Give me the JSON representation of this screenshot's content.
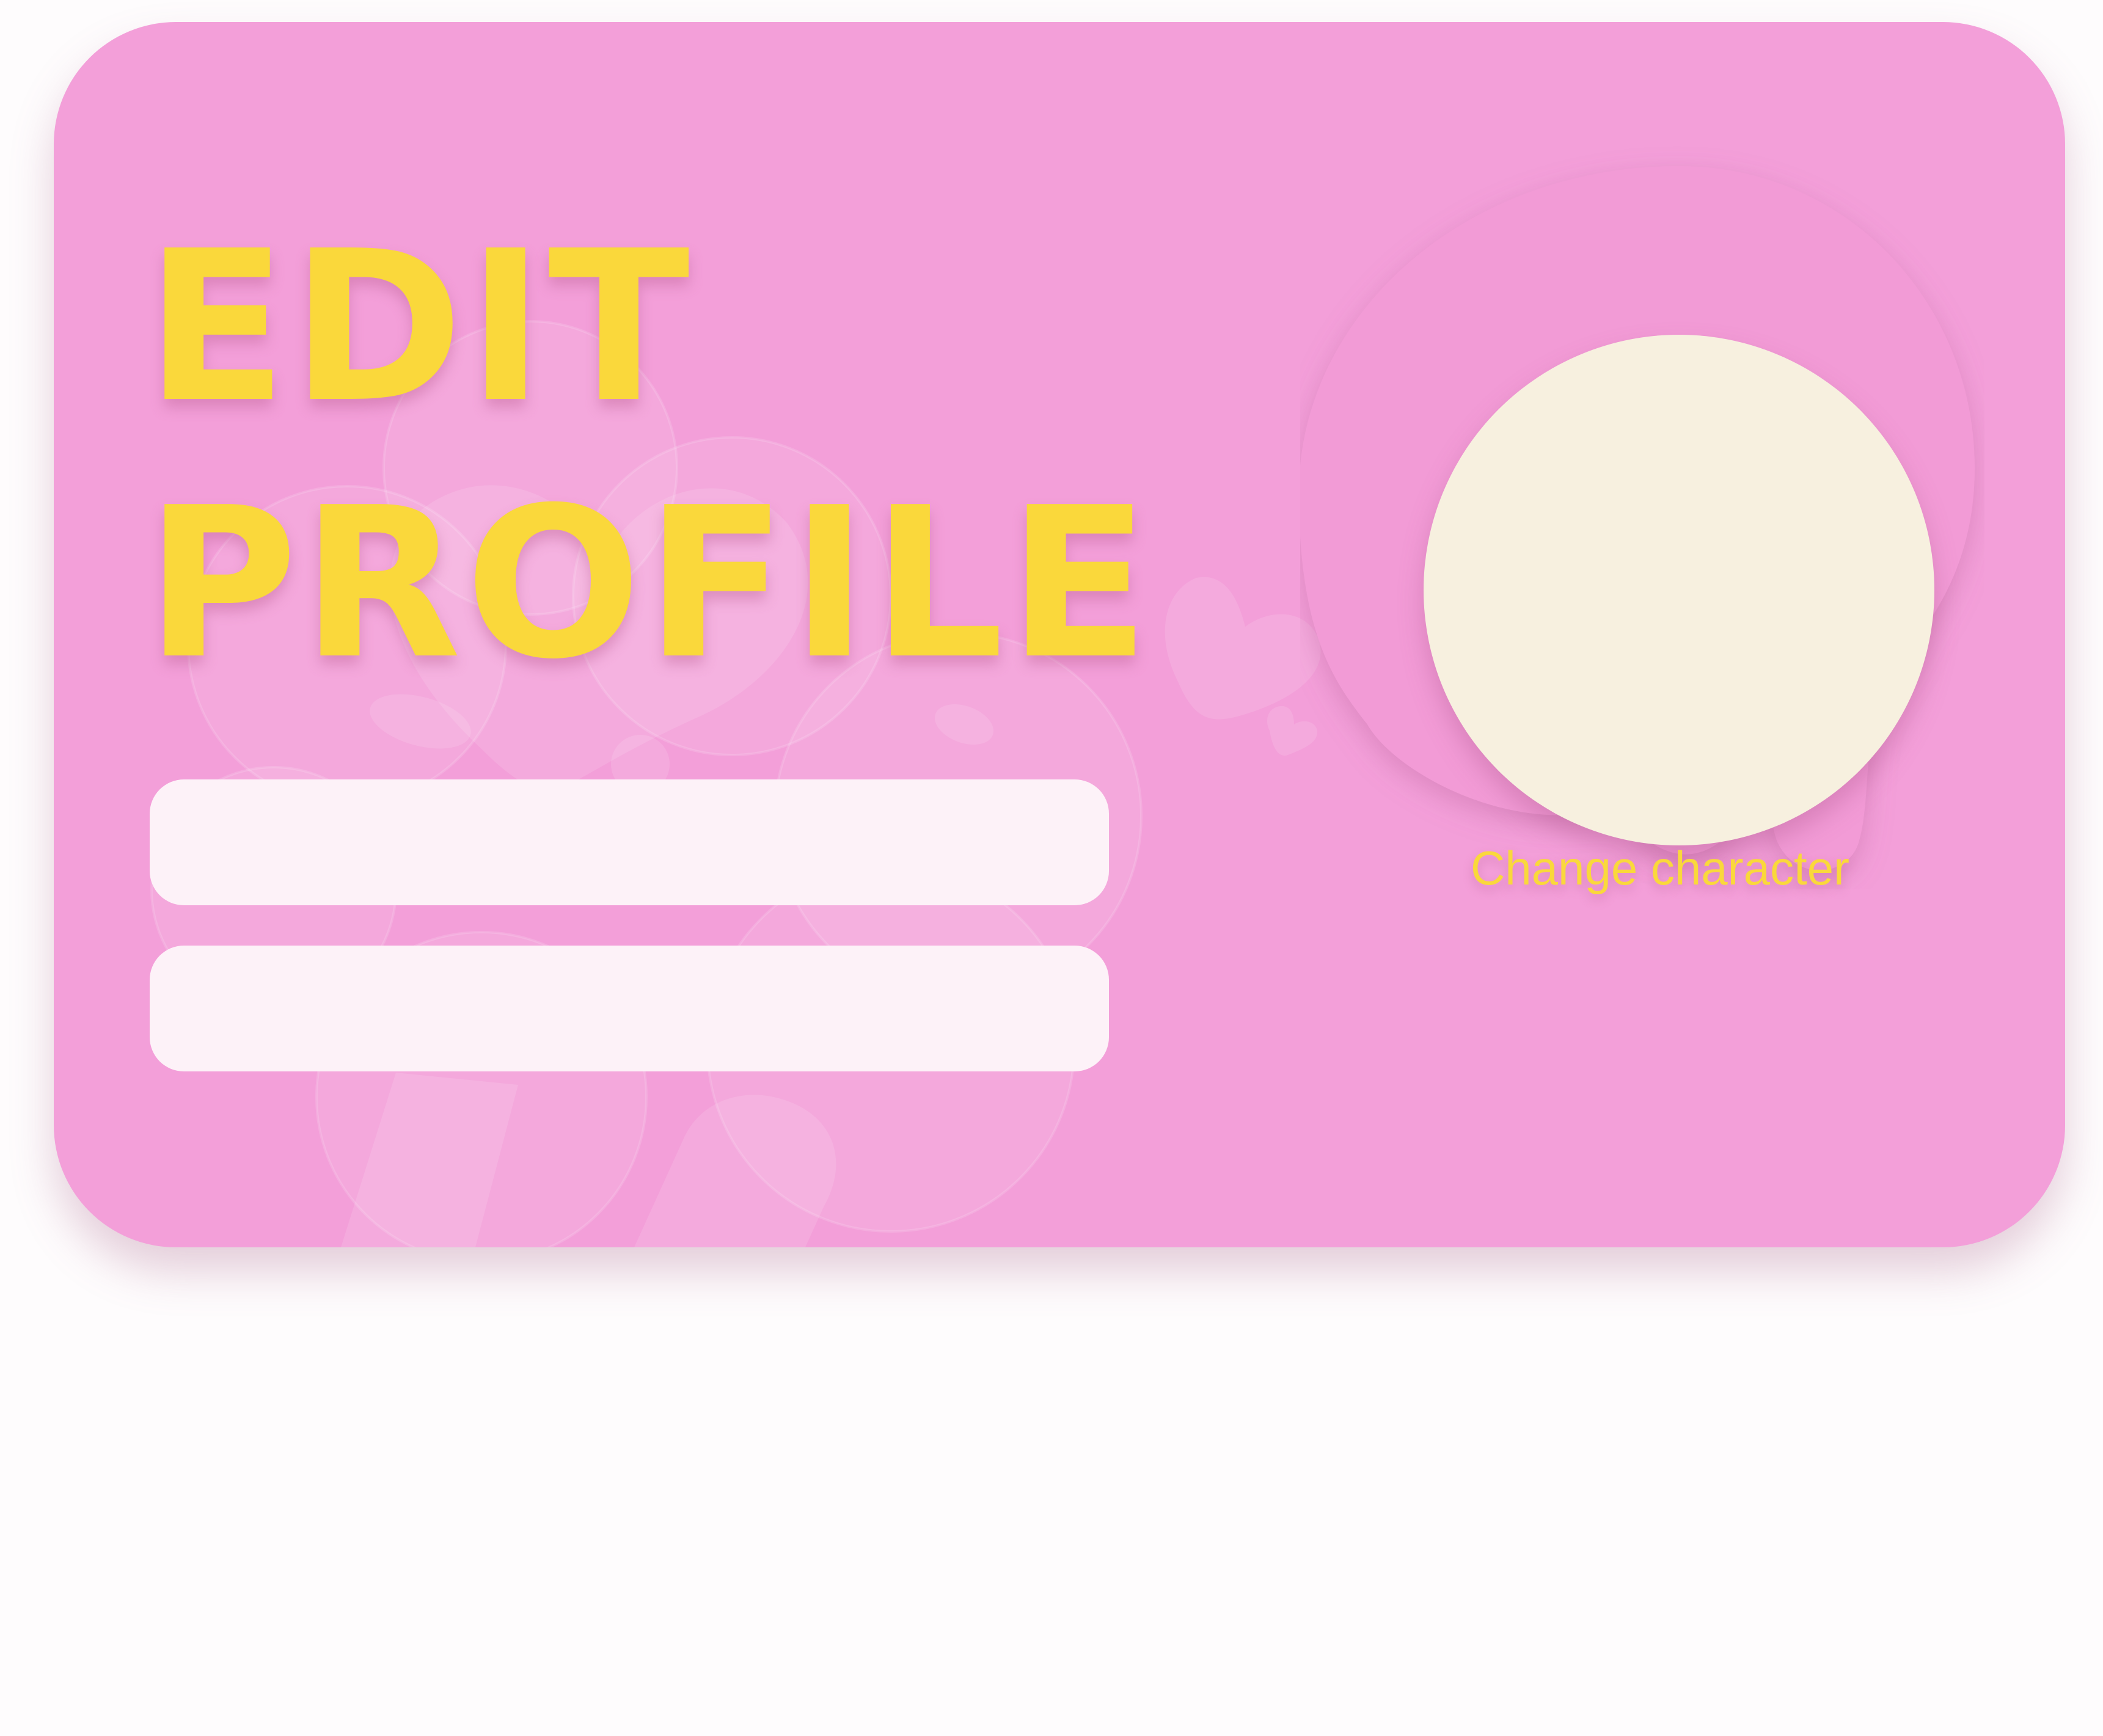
{
  "screen": {
    "title_line1": "EDIT",
    "title_line2": "PROFILE"
  },
  "form": {
    "fields": [
      {
        "label": "",
        "value": "",
        "placeholder": ""
      },
      {
        "label": "",
        "value": "",
        "placeholder": ""
      }
    ]
  },
  "avatar": {
    "change_label": "Change character"
  },
  "colors": {
    "card_background": "#f39fd9",
    "title_yellow": "#fad83b",
    "field_background": "#fdf2f8",
    "avatar_fill": "#f7f0df",
    "page_background": "#fefcfd"
  }
}
